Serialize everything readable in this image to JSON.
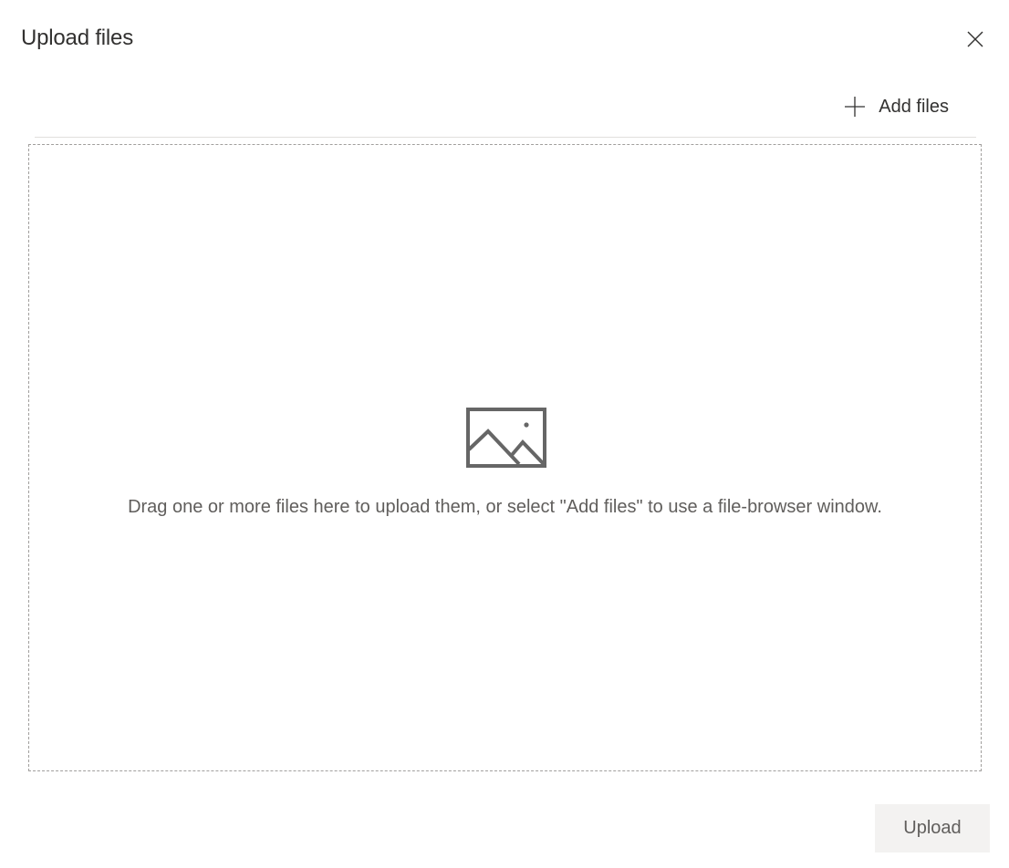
{
  "dialog": {
    "title": "Upload files"
  },
  "icons": {
    "close": "close-icon",
    "add": "plus-icon",
    "drop": "image-placeholder-icon"
  },
  "toolbar": {
    "add_files_label": "Add files"
  },
  "dropzone": {
    "instructions": "Drag one or more files here to upload them, or select \"Add files\" to use a file-browser window."
  },
  "footer": {
    "upload_label": "Upload",
    "upload_enabled": false
  },
  "colors": {
    "text": "#323130",
    "muted_text": "#605e5c",
    "icon_gray": "#666666",
    "disabled_button_bg": "#f3f2f1",
    "dropzone_border": "#a19f9d"
  }
}
